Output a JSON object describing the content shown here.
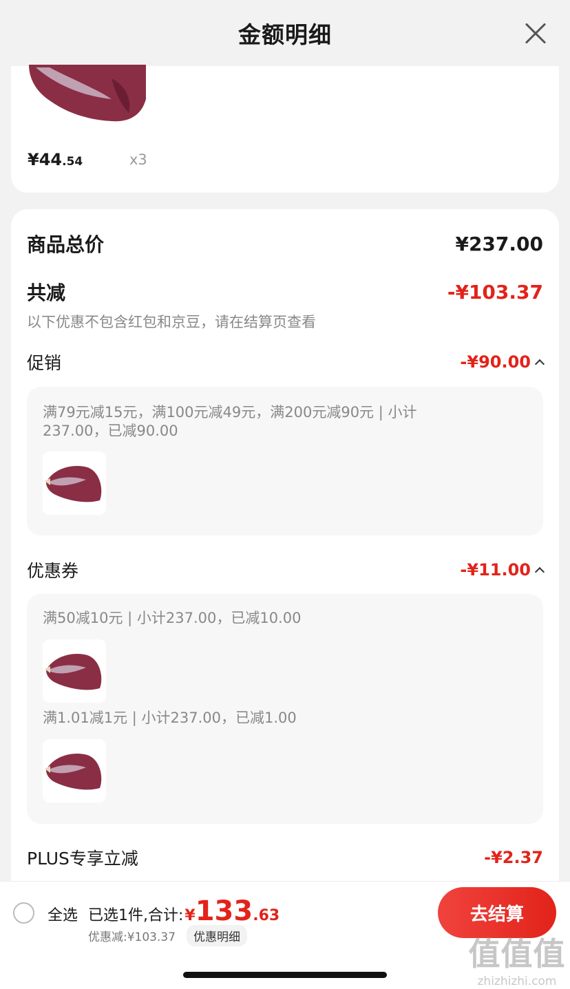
{
  "header": {
    "title": "金额明细"
  },
  "top_item": {
    "price_int": "¥44",
    "price_dec": ".54",
    "qty": "x3"
  },
  "totals": {
    "goods_label": "商品总价",
    "goods_value": "¥237.00",
    "reduce_label": "共减",
    "reduce_value": "-¥103.37",
    "note": "以下优惠不包含红包和京豆，请在结算页查看"
  },
  "promo": {
    "label": "促销",
    "value": "-¥90.00",
    "detail_line1": "满79元减15元，满100元减49元，满200元减90元 | 小计",
    "detail_line2": "237.00，已减90.00"
  },
  "coupon": {
    "label": "优惠券",
    "value": "-¥11.00",
    "rule1": "满50减10元 | 小计237.00，已减10.00",
    "rule2": "满1.01减1元 | 小计237.00，已减1.00"
  },
  "plus": {
    "label": "PLUS专享立减",
    "value": "-¥2.37"
  },
  "bottom": {
    "select_all": "全选",
    "summary_label": "已选1件,合计:",
    "yen": "¥",
    "total_int": "133",
    "total_dec": ".63",
    "discount": "优惠减:¥103.37",
    "detail_tag": "优惠明细",
    "checkout": "去结算"
  },
  "watermark": {
    "big": "值值值",
    "small": "zhizhizhi.com"
  },
  "colors": {
    "accent": "#e2231a",
    "meat": "#8a2e45"
  }
}
